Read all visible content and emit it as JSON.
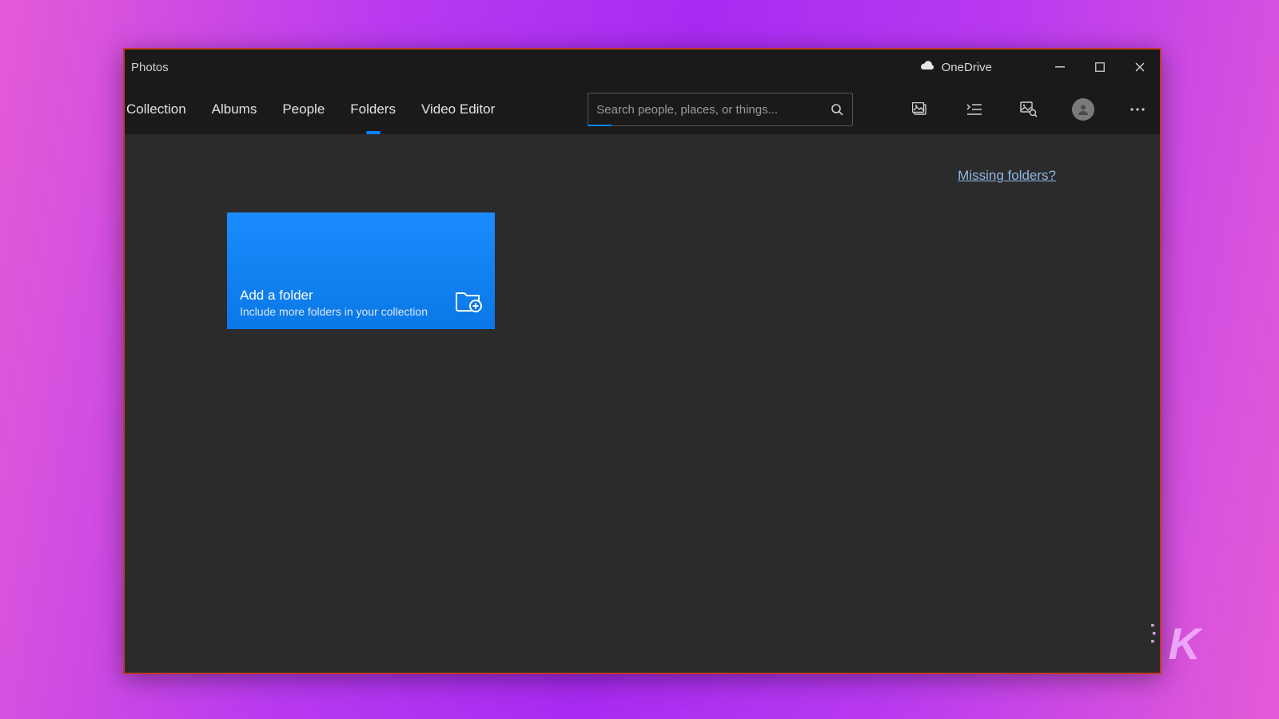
{
  "app": {
    "title": "Photos",
    "onedrive_label": "OneDrive"
  },
  "tabs": {
    "collection": "Collection",
    "albums": "Albums",
    "people": "People",
    "folders": "Folders",
    "video_editor": "Video Editor",
    "active": "folders"
  },
  "search": {
    "placeholder": "Search people, places, or things..."
  },
  "content": {
    "missing_folders_link": "Missing folders?",
    "tile": {
      "title": "Add a folder",
      "subtitle": "Include more folders in your collection"
    }
  },
  "watermark": "K"
}
